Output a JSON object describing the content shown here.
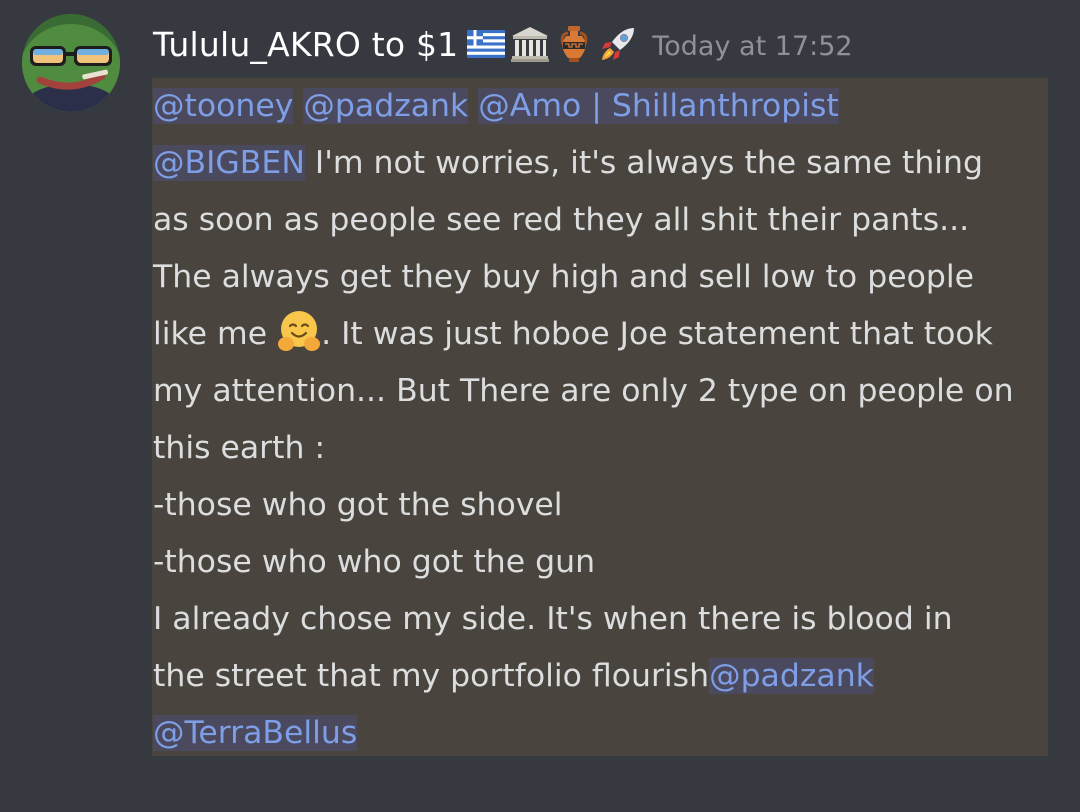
{
  "message": {
    "author": "Tululu_AKRO to $1",
    "author_emojis": [
      "greece-flag-emoji",
      "classical-building-emoji",
      "amphora-emoji",
      "rocket-emoji"
    ],
    "timestamp": "Today at 17:52",
    "mentions": {
      "tooney": "@tooney",
      "padzank": "@padzank",
      "amo": "@Amo | Shillanthropist",
      "bigben": "@BIGBEN",
      "padzank2": "@padzank",
      "terrabellus": "@TerraBellus"
    },
    "text": {
      "l2": " I'm not worries, it's always the same thing",
      "l3": "as soon as people see red they all shit their pants...",
      "l4": "The always get they buy high and sell low to people",
      "l5a": "like me ",
      "l5b": ". It was just hoboe Joe statement that took",
      "l6": "my attention... But There are only 2 type on people on",
      "l7": "this earth :",
      "l8": "-those who got the shovel",
      "l9": "-those who who got the gun",
      "l10": "I already chose my side. It's when there is blood in",
      "l11": "the street that my portfolio flourish"
    },
    "inline_emoji": "hugging-face-emoji"
  },
  "colors": {
    "background": "#36393f",
    "highlight": "#49443d",
    "mention": "#7e9ee6",
    "text": "#dcddde",
    "timestamp": "#8e9297"
  }
}
